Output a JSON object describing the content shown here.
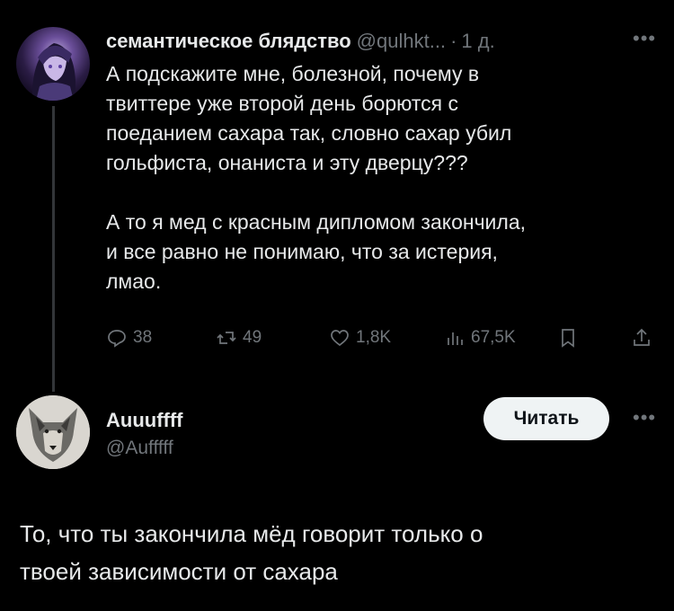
{
  "tweet1": {
    "display_name": "семантическое блядство",
    "handle": "@qulhkt...",
    "time": "1 д.",
    "paragraphs": [
      "А подскажите мне, болезной, почему в\nтвиттере уже второй день борются с\nпоеданием сахара так, словно сахар убил\nгольфиста, онаниста и эту дверцу???",
      "А то я мед с красным дипломом закончила,\nи все равно не понимаю, что за истерия,\nлмао."
    ],
    "actions": {
      "replies": "38",
      "retweets": "49",
      "likes": "1,8K",
      "views": "67,5K"
    }
  },
  "tweet2": {
    "display_name": "Auuuffff",
    "handle": "@Aufffff",
    "follow_label": "Читать",
    "text": "То, что ты закончила мёд говорит только о\nтвоей зависимости от сахара"
  },
  "icons": {
    "reply": "reply-icon",
    "retweet": "retweet-icon",
    "like": "heart-icon",
    "views": "views-icon",
    "bookmark": "bookmark-icon",
    "share": "share-icon",
    "more": "more-icon"
  },
  "colors": {
    "background": "#000000",
    "text": "#e7e9ea",
    "secondary": "#71767b",
    "button_bg": "#eff3f4"
  }
}
